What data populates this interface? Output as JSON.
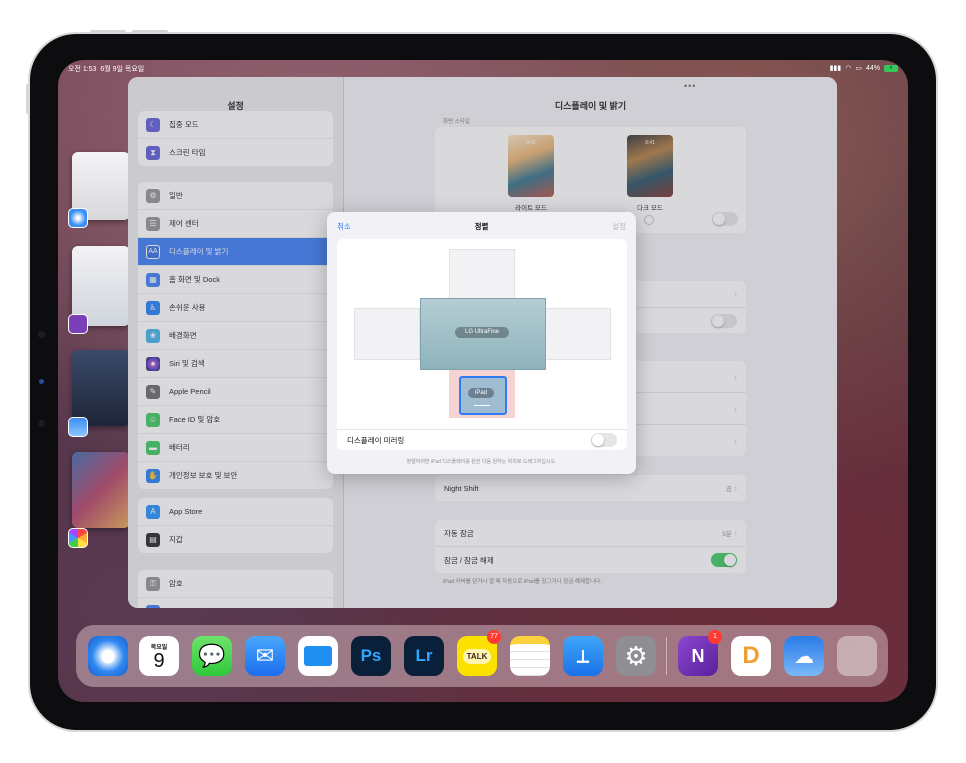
{
  "status": {
    "time": "오전 1:53",
    "date": "6월 9일 목요일",
    "battery": "44%"
  },
  "colors": {
    "accent": "#3478f6",
    "toggle_on": "#34c759",
    "badge": "#ff3b30"
  },
  "sidebar": {
    "title": "설정",
    "items": [
      {
        "label": "집중 모드",
        "icon": "moon-icon"
      },
      {
        "label": "스크린 타임",
        "icon": "hourglass-icon"
      },
      {
        "label": "일반",
        "icon": "gear-icon"
      },
      {
        "label": "제어 센터",
        "icon": "control-center-icon"
      },
      {
        "label": "디스플레이 및 밝기",
        "icon": "text-size-icon",
        "active": true
      },
      {
        "label": "홈 화면 및 Dock",
        "icon": "home-grid-icon"
      },
      {
        "label": "손쉬운 사용",
        "icon": "accessibility-icon"
      },
      {
        "label": "배경화면",
        "icon": "wallpaper-icon"
      },
      {
        "label": "Siri 및 검색",
        "icon": "siri-icon"
      },
      {
        "label": "Apple Pencil",
        "icon": "pencil-icon"
      },
      {
        "label": "Face ID 및 암호",
        "icon": "face-id-icon"
      },
      {
        "label": "배터리",
        "icon": "battery-icon"
      },
      {
        "label": "개인정보 보호 및 보안",
        "icon": "hand-icon"
      },
      {
        "label": "App Store",
        "icon": "app-store-icon"
      },
      {
        "label": "지갑",
        "icon": "wallet-icon"
      },
      {
        "label": "암호",
        "icon": "key-icon"
      }
    ]
  },
  "main": {
    "title": "디스플레이 및 밝기",
    "appearance_header": "화면 스타일",
    "light_label": "라이트 모드",
    "dark_label": "다크 모드",
    "preview_time": "9:41",
    "night_shift": {
      "label": "Night Shift",
      "value": "끔"
    },
    "auto_lock": {
      "label": "자동 잠금",
      "value": "5분"
    },
    "lock_unlock": {
      "label": "잠금 / 잠금 해제",
      "on": true
    },
    "lock_footer": "iPad 커버를 닫거나 열 때 자동으로 iPad를 잠그거나 잠금 해제합니다."
  },
  "modal": {
    "cancel": "취소",
    "title": "정렬",
    "done": "설정",
    "external_display": "LG UltraFine",
    "ipad_display": "iPad",
    "mirroring_label": "디스플레이 미러링",
    "mirroring_on": false,
    "hint": "정렬하려면 iPad 디스플레이를 원한 다음 원하는 위치로 드래그하십시오."
  },
  "dock": {
    "calendar_day": "목요일",
    "calendar_date": "9",
    "photoshop_label": "Ps",
    "lightroom_label": "Lr",
    "kakao_label": "TALK",
    "kakao_badge": "77",
    "onenote_label": "N",
    "onenote_badge": "1",
    "d_label": "D",
    "apps": [
      "Safari",
      "Calendar",
      "Messages",
      "Mail",
      "Files",
      "Photoshop",
      "Lightroom",
      "KakaoTalk",
      "Notes",
      "Keynote",
      "Settings",
      "OneNote",
      "Day One",
      "Weather",
      "App Library"
    ]
  }
}
